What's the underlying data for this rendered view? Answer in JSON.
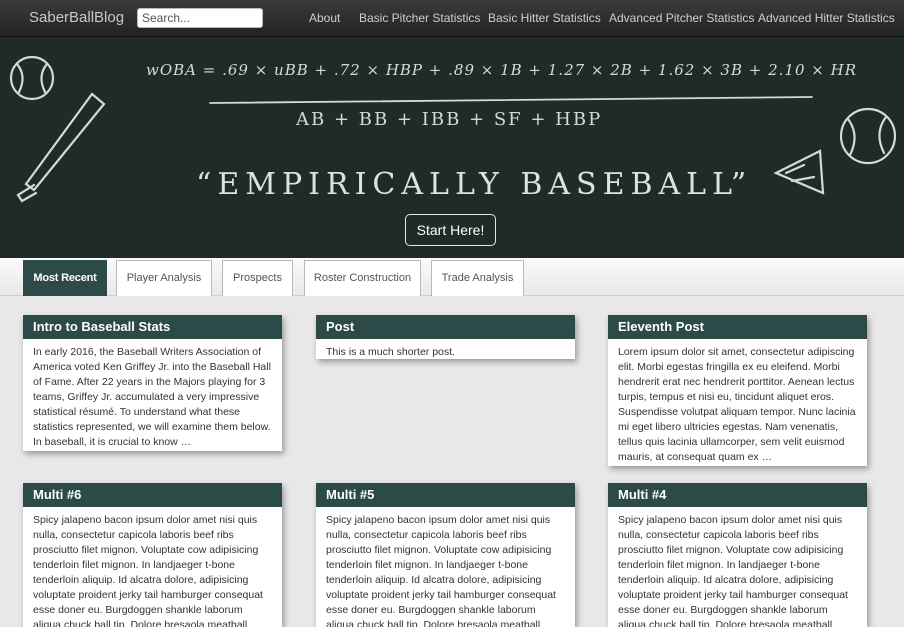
{
  "navbar": {
    "brand": "SaberBallBlog",
    "search_placeholder": "Search...",
    "links": [
      "About",
      "Basic Pitcher Statistics",
      "Basic Hitter Statistics",
      "Advanced Pitcher Statistics",
      "Advanced Hitter Statistics"
    ]
  },
  "hero": {
    "formula_numerator": "wOBA = .69 × uBB + .72 × HBP + .89 × 1B + 1.27 × 2B + 1.62 × 3B + 2.10 × HR",
    "formula_denominator": "AB + BB + IBB + SF + HBP",
    "tagline": "“EMPIRICALLY BASEBALL”",
    "button": "Start Here!",
    "colors": {
      "chalkboard": "#1f2b29",
      "chalk": "#e8ece9"
    }
  },
  "tabs": [
    "Most Recent",
    "Player Analysis",
    "Prospects",
    "Roster Construction",
    "Trade Analysis"
  ],
  "accent_color": "#2c4a47",
  "posts": [
    {
      "title": "Intro to Baseball Stats",
      "excerpt": "In early 2016, the Baseball Writers Association of America voted Ken Griffey Jr. into the Baseball Hall of Fame. After 22 years in the Majors playing for 3 teams, Griffey Jr. accumulated a very impressive statistical résumé. To understand what these statistics represented, we will examine them below. In baseball, it is crucial to know …"
    },
    {
      "title": "Post",
      "excerpt": "This is a much shorter post."
    },
    {
      "title": "Eleventh Post",
      "excerpt": "Lorem ipsum dolor sit amet, consectetur adipiscing elit. Morbi egestas fringilla ex eu eleifend. Morbi hendrerit erat nec hendrerit porttitor. Aenean lectus turpis, tempus et nisi eu, tincidunt aliquet eros. Suspendisse volutpat aliquam tempor. Nunc lacinia mi eget libero ultricies egestas. Nam venenatis, tellus quis lacinia ullamcorper, sem velit euismod mauris, at consequat quam ex …"
    },
    {
      "title": "Multi #6",
      "excerpt": "Spicy jalapeno bacon ipsum dolor amet nisi quis nulla, consectetur capicola laboris beef ribs prosciutto filet mignon. Voluptate cow adipisicing tenderloin filet mignon. In landjaeger t-bone tenderloin aliquip. Id alcatra dolore, adipisicing voluptate proident jerky tail hamburger consequat esse doner eu. Burgdoggen shankle laborum aliqua chuck ball tip. Dolore bresaola meatball"
    },
    {
      "title": "Multi #5",
      "excerpt": "Spicy jalapeno bacon ipsum dolor amet nisi quis nulla, consectetur capicola laboris beef ribs prosciutto filet mignon. Voluptate cow adipisicing tenderloin filet mignon. In landjaeger t-bone tenderloin aliquip. Id alcatra dolore, adipisicing voluptate proident jerky tail hamburger consequat esse doner eu. Burgdoggen shankle laborum aliqua chuck ball tip. Dolore bresaola meatball"
    },
    {
      "title": "Multi #4",
      "excerpt": "Spicy jalapeno bacon ipsum dolor amet nisi quis nulla, consectetur capicola laboris beef ribs prosciutto filet mignon. Voluptate cow adipisicing tenderloin filet mignon. In landjaeger t-bone tenderloin aliquip. Id alcatra dolore, adipisicing voluptate proident jerky tail hamburger consequat esse doner eu. Burgdoggen shankle laborum aliqua chuck ball tip. Dolore bresaola meatball"
    }
  ]
}
